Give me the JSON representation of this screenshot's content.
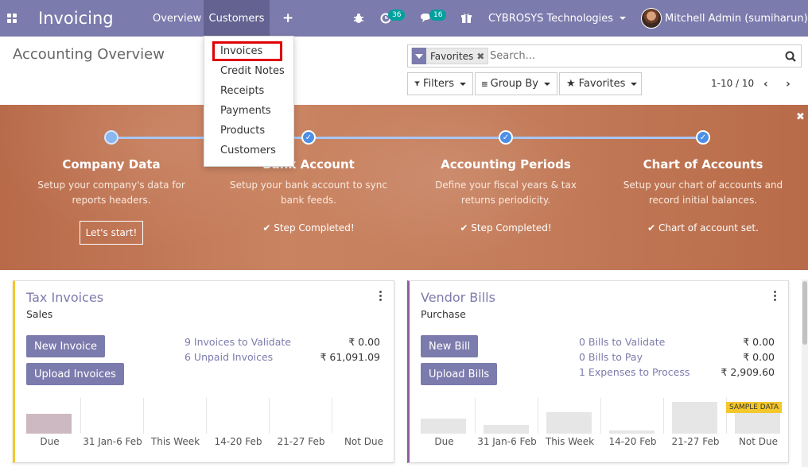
{
  "navbar": {
    "brand": "Invoicing",
    "menu_overview": "Overview",
    "menu_customers": "Customers",
    "plus": "+",
    "activity_count": "36",
    "messages_count": "16",
    "company": "CYBROSYS Technologies",
    "user": "Mitchell Admin (sumiharun)",
    "icons": [
      "apps-grid-icon",
      "bug-icon",
      "activity-clock-icon",
      "chat-icon",
      "gift-icon"
    ]
  },
  "customers_menu": {
    "items": [
      "Invoices",
      "Credit Notes",
      "Receipts",
      "Payments",
      "Products",
      "Customers"
    ],
    "highlighted": "Invoices",
    "highlight_color": "#e00000"
  },
  "control_panel": {
    "title": "Accounting Overview",
    "facet_label": "Favorites",
    "search_placeholder": "Search...",
    "filters_label": "Filters",
    "group_by_label": "Group By",
    "favorites_label": "Favorites",
    "pager": "1-10 / 10"
  },
  "onboarding": {
    "steps": [
      {
        "title": "Company Data",
        "desc_line1": "Setup your company's data for",
        "desc_line2": "reports headers.",
        "action": "Let's start!",
        "completed": false
      },
      {
        "title": "Bank Account",
        "desc_line1": "Setup your bank account to sync",
        "desc_line2": "bank feeds.",
        "status": "Step Completed!",
        "completed": true
      },
      {
        "title": "Accounting Periods",
        "desc_line1": "Define your fiscal years & tax",
        "desc_line2": "returns periodicity.",
        "status": "Step Completed!",
        "completed": true
      },
      {
        "title": "Chart of Accounts",
        "desc_line1": "Setup your chart of accounts and",
        "desc_line2": "record initial balances.",
        "status": "Chart of account set.",
        "completed": true
      }
    ]
  },
  "journals": {
    "tax": {
      "title": "Tax Invoices",
      "subtitle": "Sales",
      "accent": "#f4c72a",
      "new_button": "New Invoice",
      "upload_button": "Upload Invoices",
      "stats": [
        {
          "label": "9 Invoices to Validate",
          "value": "₹ 0.00"
        },
        {
          "label": "6 Unpaid Invoices",
          "value": "₹ 61,091.09"
        }
      ],
      "graph_labels": [
        "Due",
        "31 Jan-6 Feb",
        "This Week",
        "14-20 Feb",
        "21-27 Feb",
        "Not Due"
      ],
      "graph_values": [
        0.6,
        0,
        0,
        0,
        0,
        0
      ]
    },
    "vendor": {
      "title": "Vendor Bills",
      "subtitle": "Purchase",
      "accent": "#8e5fa0",
      "new_button": "New Bill",
      "upload_button": "Upload Bills",
      "stats": [
        {
          "label": "0 Bills to Validate",
          "value": "₹ 0.00"
        },
        {
          "label": "0 Bills to Pay",
          "value": "₹ 0.00"
        },
        {
          "label": "1 Expenses to Process",
          "value": "₹ 2,909.60"
        }
      ],
      "graph_labels": [
        "Due",
        "31 Jan-6 Feb",
        "This Week",
        "14-20 Feb",
        "21-27 Feb",
        "Not Due"
      ],
      "graph_values": [
        0.45,
        0.25,
        0.65,
        0.1,
        0.95,
        0.85
      ],
      "sample_badge": "SAMPLE DATA"
    }
  }
}
